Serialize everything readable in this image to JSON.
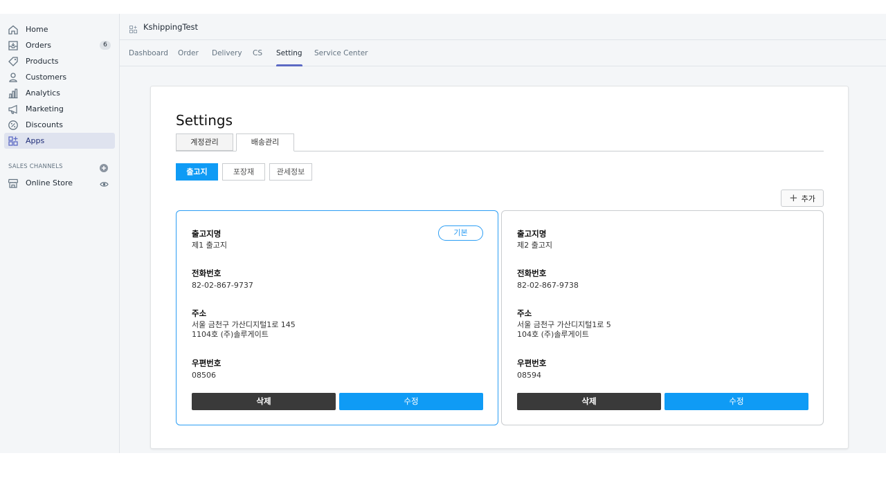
{
  "sidebar": {
    "items": [
      {
        "label": "Home",
        "icon": "home-icon"
      },
      {
        "label": "Orders",
        "icon": "orders-icon",
        "badge": "6"
      },
      {
        "label": "Products",
        "icon": "tag-icon"
      },
      {
        "label": "Customers",
        "icon": "person-icon"
      },
      {
        "label": "Analytics",
        "icon": "bar-chart-icon"
      },
      {
        "label": "Marketing",
        "icon": "megaphone-icon"
      },
      {
        "label": "Discounts",
        "icon": "discount-icon"
      },
      {
        "label": "Apps",
        "icon": "apps-icon",
        "active": true
      }
    ],
    "sales_channels_title": "SALES CHANNELS",
    "online_store": "Online Store"
  },
  "topbar": {
    "app_name": "KshippingTest"
  },
  "tabs": [
    "Dashboard",
    "Order",
    "Delivery",
    "CS",
    "Setting",
    "Service Center"
  ],
  "active_tab": "Setting",
  "settings": {
    "title": "Settings",
    "main_tabs": [
      "계정관리",
      "배송관리"
    ],
    "sub_tabs": [
      "출고지",
      "포장재",
      "관세정보"
    ],
    "add_label": "추가"
  },
  "labels": {
    "name": "출고지명",
    "phone": "전화번호",
    "address": "주소",
    "zip": "우편번호",
    "default": "기본",
    "delete": "삭제",
    "edit": "수정"
  },
  "warehouses": [
    {
      "name": "제1 출고지",
      "phone": "82-02-867-9737",
      "address1": "서울 금천구 가산디지털1로 145",
      "address2": "1104호 (주)솔루게이트",
      "zip": "08506",
      "is_default": true
    },
    {
      "name": "제2 출고지",
      "phone": "82-02-867-9738",
      "address1": "서울 금천구 가산디지털1로 5",
      "address2": "104호 (주)솔루게이트",
      "zip": "08594",
      "is_default": false
    }
  ],
  "colors": {
    "accent": "#0f9bf5",
    "nav_active": "#5c6ac4",
    "dark_button": "#3a3a3a"
  }
}
